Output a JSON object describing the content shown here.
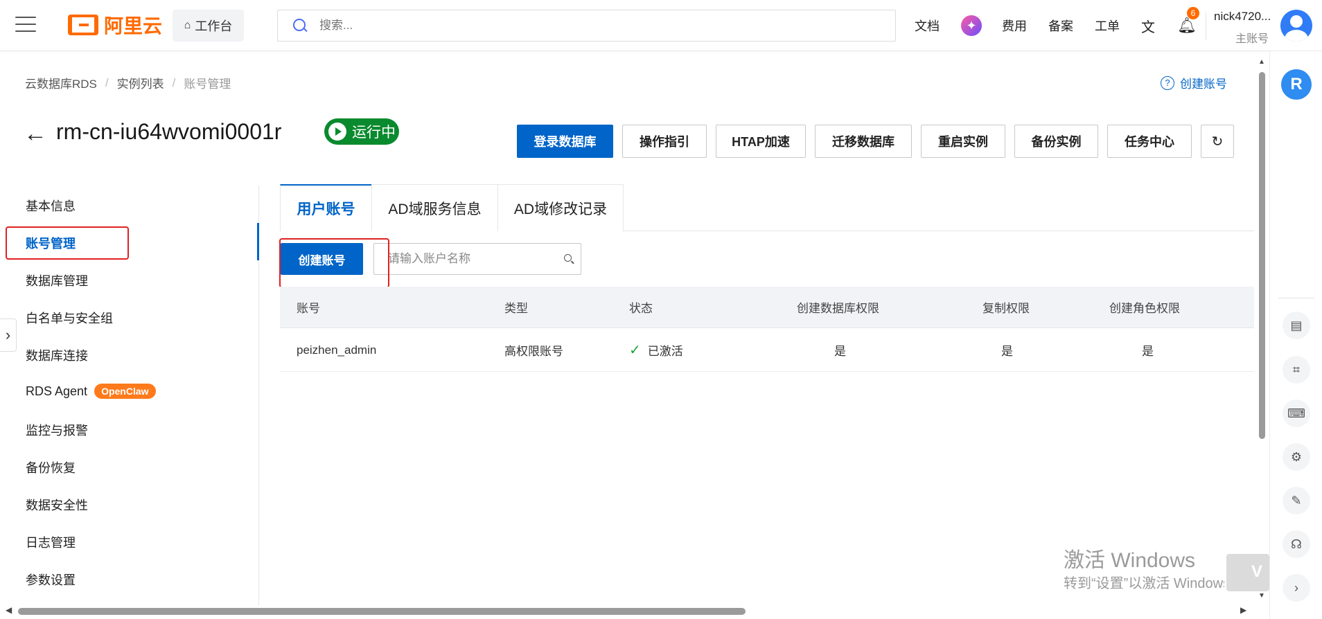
{
  "header": {
    "brand": "阿里云",
    "workbench_label": "工作台",
    "search_placeholder": "搜索...",
    "links": [
      "文档",
      "费用",
      "备案",
      "工单"
    ],
    "notification_count": "6",
    "user_name": "nick4720...",
    "user_role": "主账号"
  },
  "breadcrumb": {
    "items": [
      "云数据库RDS",
      "实例列表",
      "账号管理"
    ]
  },
  "help_link": "创建账号",
  "instance": {
    "id": "rm-cn-iu64wvomi0001r",
    "status": "运行中"
  },
  "toolbar": {
    "buttons": [
      "登录数据库",
      "操作指引",
      "HTAP加速",
      "迁移数据库",
      "重启实例",
      "备份实例",
      "任务中心"
    ]
  },
  "sidebar": {
    "items": [
      {
        "label": "基本信息"
      },
      {
        "label": "账号管理"
      },
      {
        "label": "数据库管理"
      },
      {
        "label": "白名单与安全组"
      },
      {
        "label": "数据库连接"
      },
      {
        "label": "RDS Agent",
        "tag": "OpenClaw"
      },
      {
        "label": "监控与报警"
      },
      {
        "label": "备份恢复"
      },
      {
        "label": "数据安全性"
      },
      {
        "label": "日志管理"
      },
      {
        "label": "参数设置"
      }
    ]
  },
  "tabs": [
    "用户账号",
    "AD域服务信息",
    "AD域修改记录"
  ],
  "actions": {
    "create_label": "创建账号",
    "search_placeholder": "请输入账户名称"
  },
  "table": {
    "columns": [
      "账号",
      "类型",
      "状态",
      "创建数据库权限",
      "复制权限",
      "创建角色权限"
    ],
    "rows": [
      {
        "account": "peizhen_admin",
        "type": "高权限账号",
        "status": "已激活",
        "create_db": "是",
        "replication": "是",
        "create_role": "是"
      }
    ]
  },
  "watermark": {
    "line1": "激活 Windows",
    "line2": "转到“设置”以激活 Windows。"
  },
  "colors": {
    "primary": "#0064c8",
    "brand_orange": "#ff6a00",
    "status_green": "#0a8a2e",
    "highlight_red": "#e02020"
  }
}
